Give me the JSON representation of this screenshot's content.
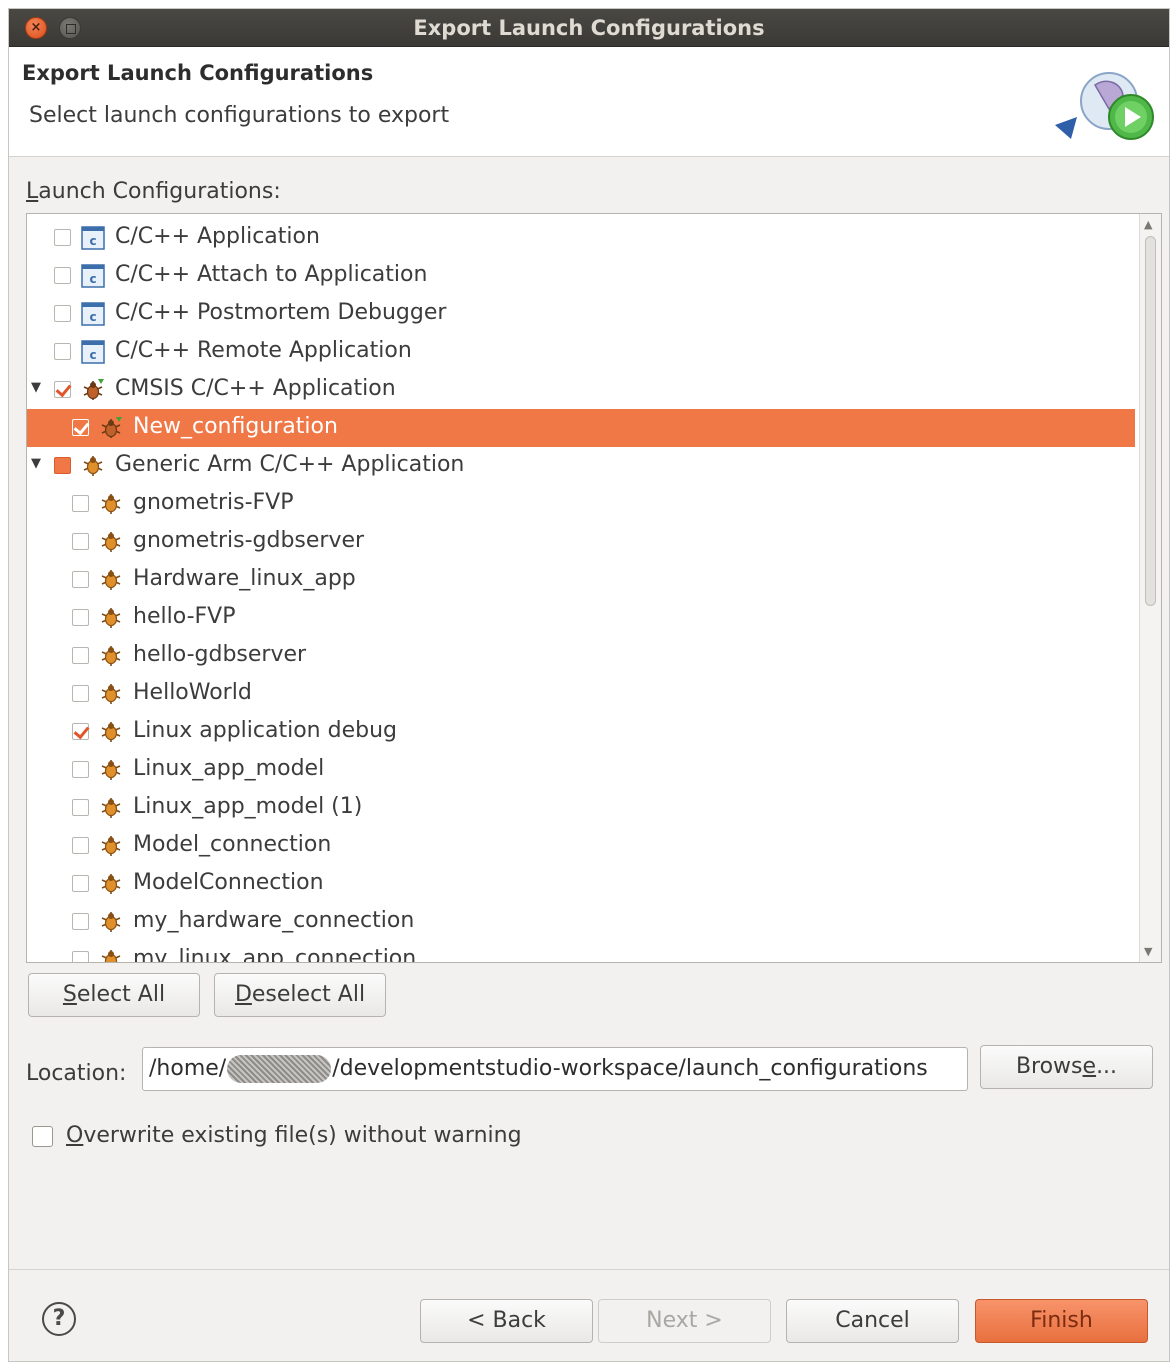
{
  "window": {
    "title": "Export Launch Configurations",
    "close_glyph": "×"
  },
  "header": {
    "title": "Export Launch Configurations",
    "description": "Select launch configurations to export",
    "icon": "export-wizard-icon"
  },
  "configs": {
    "label_accel": "L",
    "label_rest": "aunch Configurations:",
    "rows": [
      {
        "label": "C/C++ Application",
        "icon": "c-app-icon",
        "state": "unchecked",
        "level": 0,
        "expander": ""
      },
      {
        "label": "C/C++ Attach to Application",
        "icon": "c-app-icon",
        "state": "unchecked",
        "level": 0,
        "expander": ""
      },
      {
        "label": "C/C++ Postmortem Debugger",
        "icon": "c-app-icon",
        "state": "unchecked",
        "level": 0,
        "expander": ""
      },
      {
        "label": "C/C++ Remote Application",
        "icon": "c-app-icon",
        "state": "unchecked",
        "level": 0,
        "expander": ""
      },
      {
        "label": "CMSIS C/C++ Application",
        "icon": "cmsis-bug-icon",
        "state": "checked",
        "level": 0,
        "expander": "▼"
      },
      {
        "label": "New_configuration",
        "icon": "cmsis-bug-icon",
        "state": "checked",
        "level": 1,
        "expander": "",
        "selected": true
      },
      {
        "label": "Generic Arm C/C++ Application",
        "icon": "bug-icon",
        "state": "grayed",
        "level": 0,
        "expander": "▼"
      },
      {
        "label": "gnometris-FVP",
        "icon": "bug-icon",
        "state": "unchecked",
        "level": 1,
        "expander": ""
      },
      {
        "label": "gnometris-gdbserver",
        "icon": "bug-icon",
        "state": "unchecked",
        "level": 1,
        "expander": ""
      },
      {
        "label": "Hardware_linux_app",
        "icon": "bug-icon",
        "state": "unchecked",
        "level": 1,
        "expander": ""
      },
      {
        "label": "hello-FVP",
        "icon": "bug-icon",
        "state": "unchecked",
        "level": 1,
        "expander": ""
      },
      {
        "label": "hello-gdbserver",
        "icon": "bug-icon",
        "state": "unchecked",
        "level": 1,
        "expander": ""
      },
      {
        "label": "HelloWorld",
        "icon": "bug-icon",
        "state": "unchecked",
        "level": 1,
        "expander": ""
      },
      {
        "label": "Linux application debug",
        "icon": "bug-icon",
        "state": "checked",
        "level": 1,
        "expander": ""
      },
      {
        "label": "Linux_app_model",
        "icon": "bug-icon",
        "state": "unchecked",
        "level": 1,
        "expander": ""
      },
      {
        "label": "Linux_app_model (1)",
        "icon": "bug-icon",
        "state": "unchecked",
        "level": 1,
        "expander": ""
      },
      {
        "label": "Model_connection",
        "icon": "bug-icon",
        "state": "unchecked",
        "level": 1,
        "expander": ""
      },
      {
        "label": "ModelConnection",
        "icon": "bug-icon",
        "state": "unchecked",
        "level": 1,
        "expander": ""
      },
      {
        "label": "my_hardware_connection",
        "icon": "bug-icon",
        "state": "unchecked",
        "level": 1,
        "expander": ""
      },
      {
        "label": "my_linux_app_connection",
        "icon": "bug-icon",
        "state": "unchecked",
        "level": 1,
        "expander": ""
      }
    ]
  },
  "buttons": {
    "select_all_accel": "S",
    "select_all_rest": "elect All",
    "deselect_all_accel": "D",
    "deselect_all_rest": "eselect All",
    "browse_pre": "Brows",
    "browse_accel": "e",
    "browse_post": "...",
    "back": "< Back",
    "next": "Next >",
    "cancel": "Cancel",
    "finish": "Finish"
  },
  "location": {
    "label": "Location:",
    "path_prefix": "/home/",
    "path_suffix": "/developmentstudio-workspace/launch_configurations"
  },
  "overwrite": {
    "accel": "O",
    "rest": "verwrite existing file(s) without warning",
    "checked": false
  },
  "help": {
    "glyph": "?"
  },
  "colors": {
    "accent": "#f07746",
    "titlebar": "#3c3b37",
    "dialog_bg": "#f2f1f0"
  }
}
